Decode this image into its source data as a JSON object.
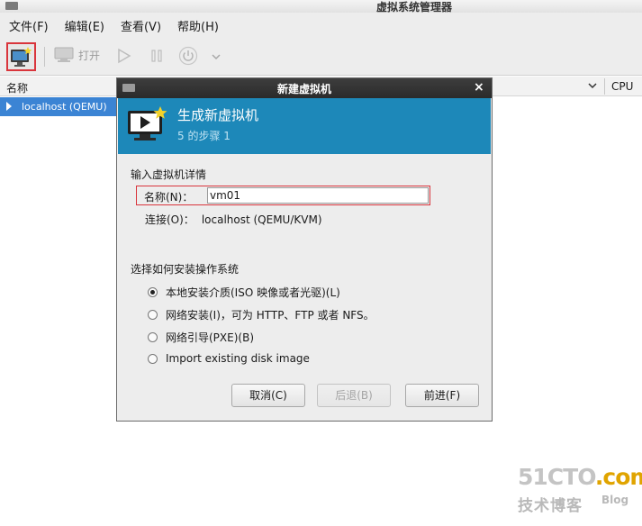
{
  "window": {
    "title": "虚拟系统管理器"
  },
  "menu": [
    "文件(F)",
    "编辑(E)",
    "查看(V)",
    "帮助(H)"
  ],
  "toolbar": {
    "open_label": "打开"
  },
  "list": {
    "col_name": "名称",
    "col_cpu": "CPU",
    "rows": [
      {
        "label": "localhost (QEMU)"
      }
    ]
  },
  "dialog": {
    "title": "新建虚拟机",
    "close_glyph": "×",
    "banner_title": "生成新虚拟机",
    "banner_step": "5 的步骤 1",
    "details_heading": "输入虚拟机详情",
    "name_label": "名称(N)：",
    "name_value": "vm01",
    "connection_label": "连接(O)：",
    "connection_value": "localhost (QEMU/KVM)",
    "install_heading": "选择如何安装操作系统",
    "options": [
      {
        "label": "本地安装介质(ISO 映像或者光驱)(L)",
        "selected": true
      },
      {
        "label": "网络安装(I)，可为 HTTP、FTP 或者 NFS。",
        "selected": false
      },
      {
        "label": "网络引导(PXE)(B)",
        "selected": false
      },
      {
        "label": "Import existing disk image",
        "selected": false
      }
    ],
    "buttons": {
      "cancel": "取消(C)",
      "back": "后退(B)",
      "forward": "前进(F)"
    }
  },
  "watermark": {
    "line1a": "51CTO",
    "line1b": ".com",
    "line2": "技术博客",
    "line3": "Blog"
  },
  "colors": {
    "banner": "#1d88b9",
    "selection": "#3b84d4",
    "highlight_border": "#d9353c"
  }
}
